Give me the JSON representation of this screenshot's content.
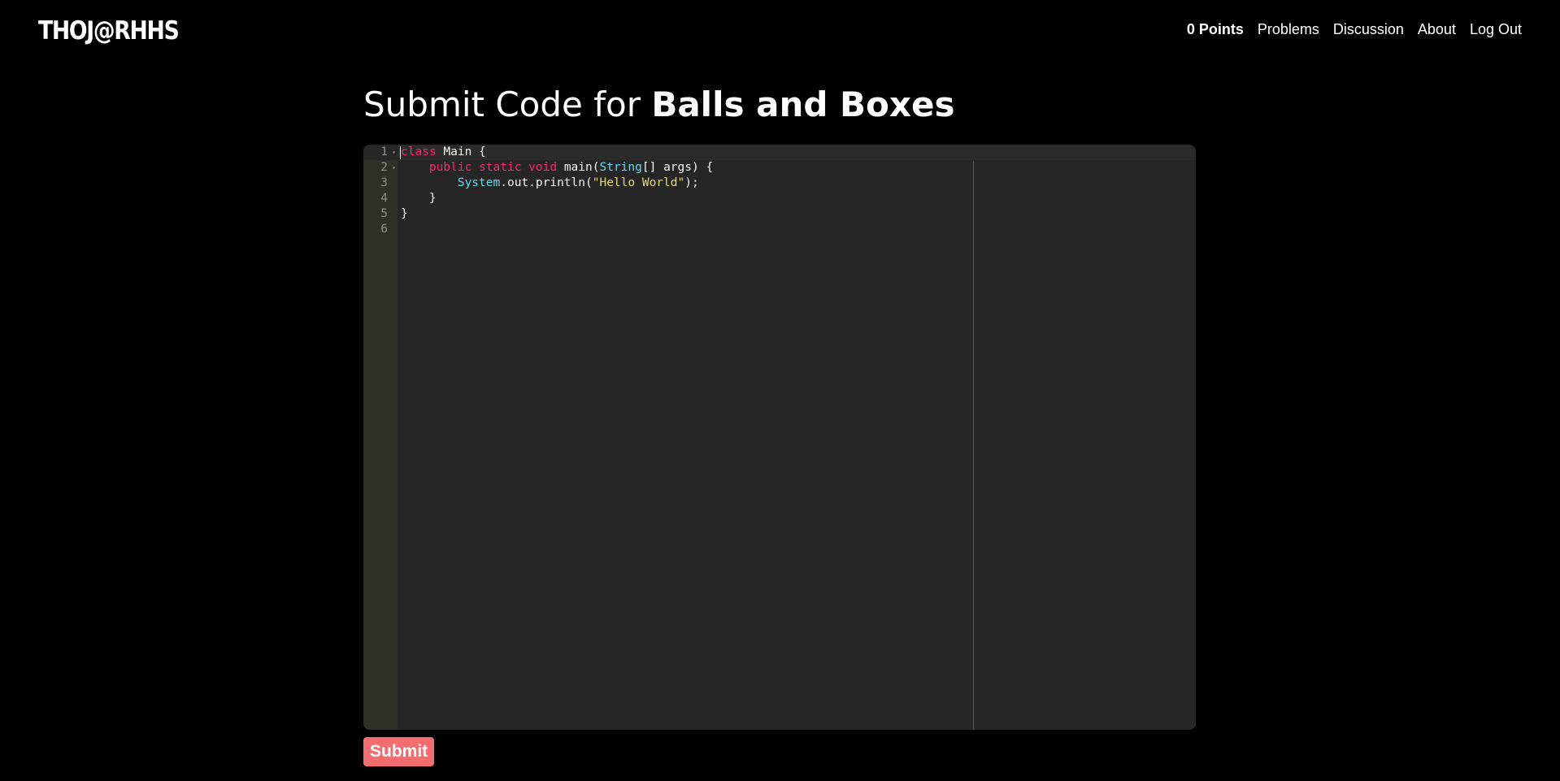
{
  "brand": "THOJ@RHHS",
  "nav": {
    "points": "0 Points",
    "problems": "Problems",
    "discussion": "Discussion",
    "about": "About",
    "logout": "Log Out"
  },
  "page": {
    "title_prefix": "Submit Code for",
    "problem_name": "Balls and Boxes"
  },
  "editor": {
    "line_numbers": [
      "1",
      "2",
      "3",
      "4",
      "5",
      "6"
    ],
    "lines": [
      [
        {
          "t": "class",
          "c": "kw"
        },
        {
          "t": " Main {",
          "c": ""
        }
      ],
      [
        {
          "t": "    ",
          "c": ""
        },
        {
          "t": "public",
          "c": "kw"
        },
        {
          "t": " ",
          "c": ""
        },
        {
          "t": "static",
          "c": "kw"
        },
        {
          "t": " ",
          "c": ""
        },
        {
          "t": "void",
          "c": "kw"
        },
        {
          "t": " main(",
          "c": ""
        },
        {
          "t": "String",
          "c": "ty"
        },
        {
          "t": "[] args) {",
          "c": ""
        }
      ],
      [
        {
          "t": "        ",
          "c": ""
        },
        {
          "t": "System",
          "c": "ty"
        },
        {
          "t": ".out.println(",
          "c": ""
        },
        {
          "t": "\"Hello World\"",
          "c": "st"
        },
        {
          "t": ");",
          "c": ""
        }
      ],
      [
        {
          "t": "    }",
          "c": ""
        }
      ],
      [
        {
          "t": "}",
          "c": ""
        }
      ],
      [
        {
          "t": "",
          "c": ""
        }
      ]
    ],
    "fold_lines": [
      "1",
      "2"
    ]
  },
  "submit_label": "Submit"
}
